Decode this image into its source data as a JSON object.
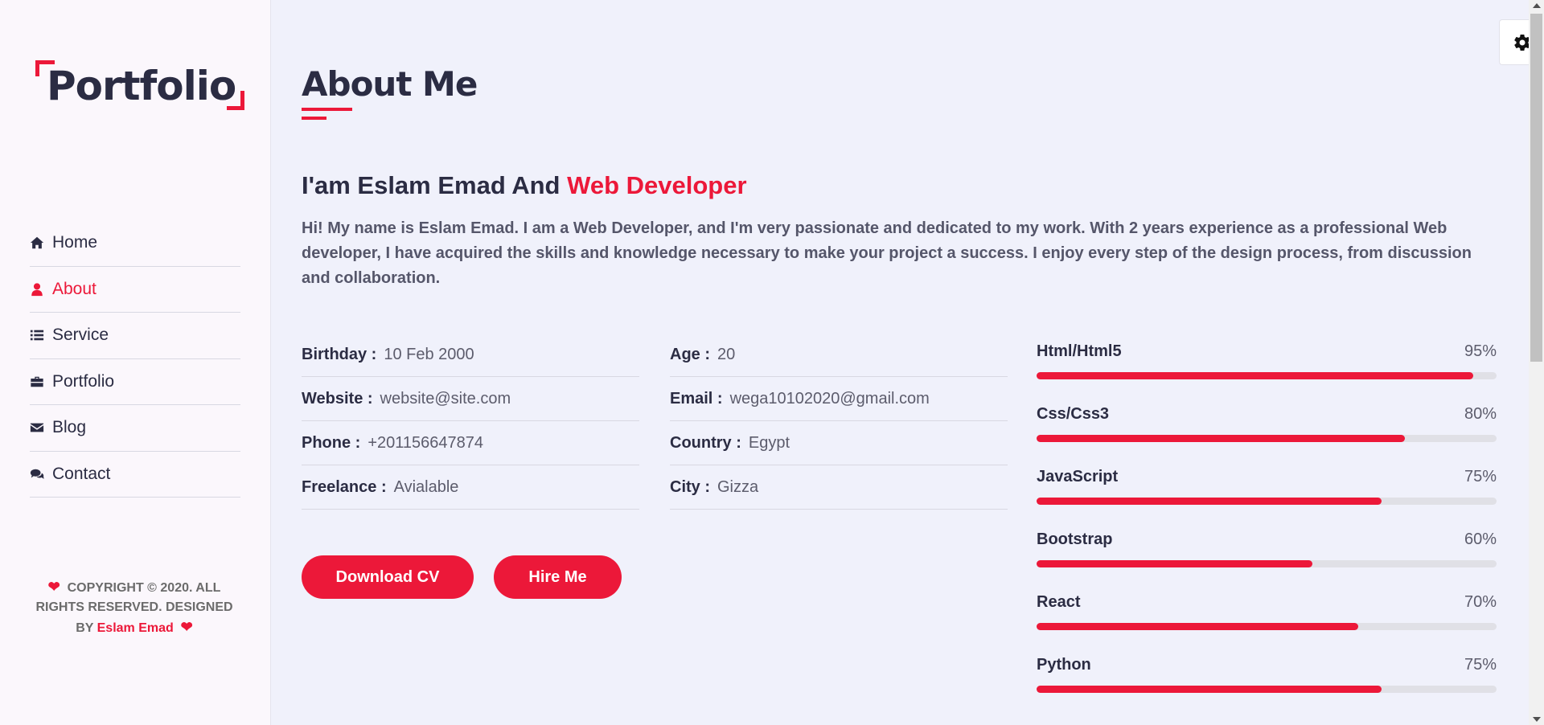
{
  "sidebar": {
    "logo": "Portfolio",
    "nav": [
      {
        "label": "Home",
        "icon": "home-icon",
        "active": false
      },
      {
        "label": "About",
        "icon": "user-icon",
        "active": true
      },
      {
        "label": "Service",
        "icon": "list-icon",
        "active": false
      },
      {
        "label": "Portfolio",
        "icon": "briefcase-icon",
        "active": false
      },
      {
        "label": "Blog",
        "icon": "envelope-icon",
        "active": false
      },
      {
        "label": "Contact",
        "icon": "comments-icon",
        "active": false
      }
    ],
    "copyright": {
      "text": "COPYRIGHT © 2020. ALL RIGHTS RESERVED. DESIGNED BY",
      "author": "Eslam Emad"
    }
  },
  "main": {
    "title": "About Me",
    "headline": {
      "prefix": "I'am Eslam Emad And",
      "accent": "Web Developer"
    },
    "intro": "Hi! My name is Eslam Emad. I am a Web Developer, and I'm very passionate and dedicated to my work. With 2 years experience as a professional Web developer, I have acquired the skills and knowledge necessary to make your project a success. I enjoy every step of the design process, from discussion and collaboration.",
    "info_left": [
      {
        "key": "Birthday :",
        "value": "10 Feb 2000"
      },
      {
        "key": "Website :",
        "value": "website@site.com"
      },
      {
        "key": "Phone :",
        "value": "+201156647874"
      },
      {
        "key": "Freelance :",
        "value": "Avialable"
      }
    ],
    "info_right": [
      {
        "key": "Age :",
        "value": "20"
      },
      {
        "key": "Email :",
        "value": "wega10102020@gmail.com"
      },
      {
        "key": "Country :",
        "value": "Egypt"
      },
      {
        "key": "City :",
        "value": "Gizza"
      }
    ],
    "buttons": {
      "download_cv": "Download CV",
      "hire_me": "Hire Me"
    },
    "skills": [
      {
        "name": "Html/Html5",
        "percent": 95,
        "label": "95%"
      },
      {
        "name": "Css/Css3",
        "percent": 80,
        "label": "80%"
      },
      {
        "name": "JavaScript",
        "percent": 75,
        "label": "75%"
      },
      {
        "name": "Bootstrap",
        "percent": 60,
        "label": "60%"
      },
      {
        "name": "React",
        "percent": 70,
        "label": "70%"
      },
      {
        "name": "Python",
        "percent": 75,
        "label": "75%"
      }
    ]
  },
  "settings": {
    "icon": "gear-icon"
  },
  "colors": {
    "accent": "#ec1839",
    "text": "#2b2c43",
    "background": "#f0f1fb",
    "sidebar": "#fbf7fc"
  }
}
